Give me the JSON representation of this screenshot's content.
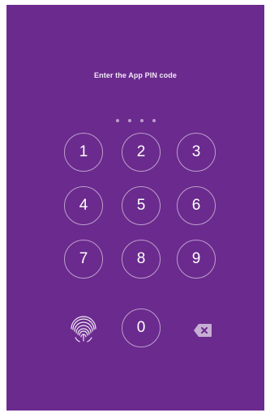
{
  "pin": {
    "title": "Enter the App PIN code",
    "dots_count": 4
  },
  "keypad": {
    "keys": [
      "1",
      "2",
      "3",
      "4",
      "5",
      "6",
      "7",
      "8",
      "9",
      "0"
    ],
    "fingerprint_icon": "fingerprint-icon",
    "backspace_icon": "backspace-icon"
  },
  "colors": {
    "background": "#6b2a8e",
    "key_border": "#d8c3e4",
    "text": "#ffffff"
  }
}
